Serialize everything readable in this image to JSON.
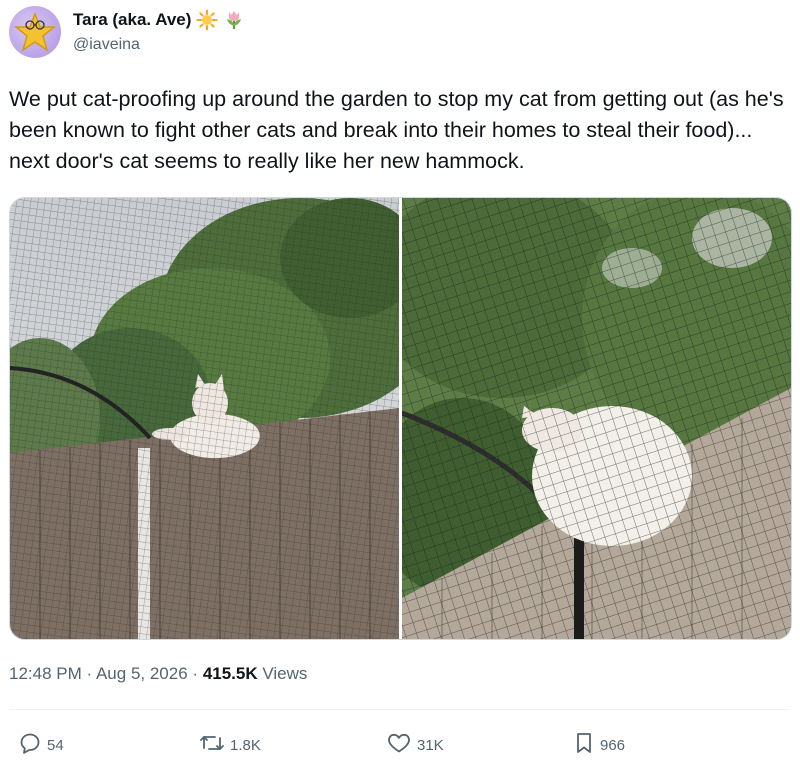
{
  "tweet": {
    "display_name": "Tara (aka. Ave)",
    "handle": "@iaveina",
    "text": "We put cat-proofing up around the garden to stop my cat from getting out (as he's been known to fight other cats and break into their homes to steal their food)... next door's cat seems to really like her new hammock.",
    "time": "12:48 PM",
    "date": "Aug 5, 2026",
    "views_count": "415.5K",
    "views_label": "Views",
    "separator": "·"
  },
  "actions": {
    "replies": "54",
    "reposts": "1.8K",
    "likes": "31K",
    "bookmarks": "966"
  },
  "icons": [
    "sun-icon",
    "tulip-icon",
    "reply-icon",
    "repost-icon",
    "like-icon",
    "bookmark-icon"
  ],
  "colors": {
    "text": "#0f1419",
    "secondary": "#536471",
    "divider": "#eff3f4"
  }
}
